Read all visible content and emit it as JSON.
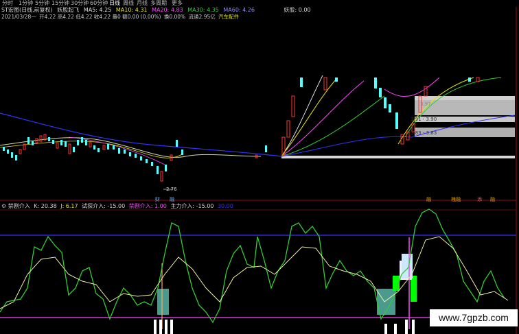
{
  "toolbar": {
    "tabs": [
      "分时",
      "1分钟",
      "5分钟",
      "15分钟",
      "30分钟",
      "60分钟",
      "日线",
      "周线",
      "月线",
      "多周期",
      "更多"
    ]
  },
  "header": {
    "stock": "ST宏图(日线,前复权)",
    "indicator_name": "妖股起飞",
    "ma5": "MA5: 4.25",
    "ma10": "MA10: 4.31",
    "ma20": "MA20: 4.83",
    "ma30": "MA30: 4.35",
    "ma60": "MA60: 4.26",
    "yaoguqifei": "妖股: 0.00",
    "info_date": "2021/03/28一",
    "info_open": "开4.22",
    "info_high": "高4.22",
    "info_low": "低4.22",
    "info_close": "收4.22",
    "info_volume": "量0 额0.00",
    "info_change": "(0.00%)",
    "info_turnover": "换0.00%",
    "info_float": "流通2.95亿",
    "info_sector": "汽车配件"
  },
  "main_chart": {
    "low_label": "2.76",
    "label_a": "3.97",
    "label_b": "3.91 - 3.90",
    "label_c": "3.83 - 3.83"
  },
  "event_markers": [
    "财",
    "融",
    "融",
    "拽融",
    "添",
    "融"
  ],
  "indicator": {
    "title": "禁剧介入",
    "k": "K: 20.38",
    "j": "J: 6.17",
    "test_entry": "试探介入: -15.00",
    "catch_entry": "禁剧介入: 1.00",
    "main_entry": "主力介入: -15.00",
    "extra": "30.00"
  },
  "watermark": "www.7gpzb.com",
  "colors": {
    "up": "#ff3232",
    "down": "#54ffff",
    "blue_line": "#3232ff",
    "magenta": "#ff44ff",
    "green_k": "#33cc33",
    "yellow_d": "#f0f0a0",
    "teal_bar": "#4a9a8e"
  }
}
